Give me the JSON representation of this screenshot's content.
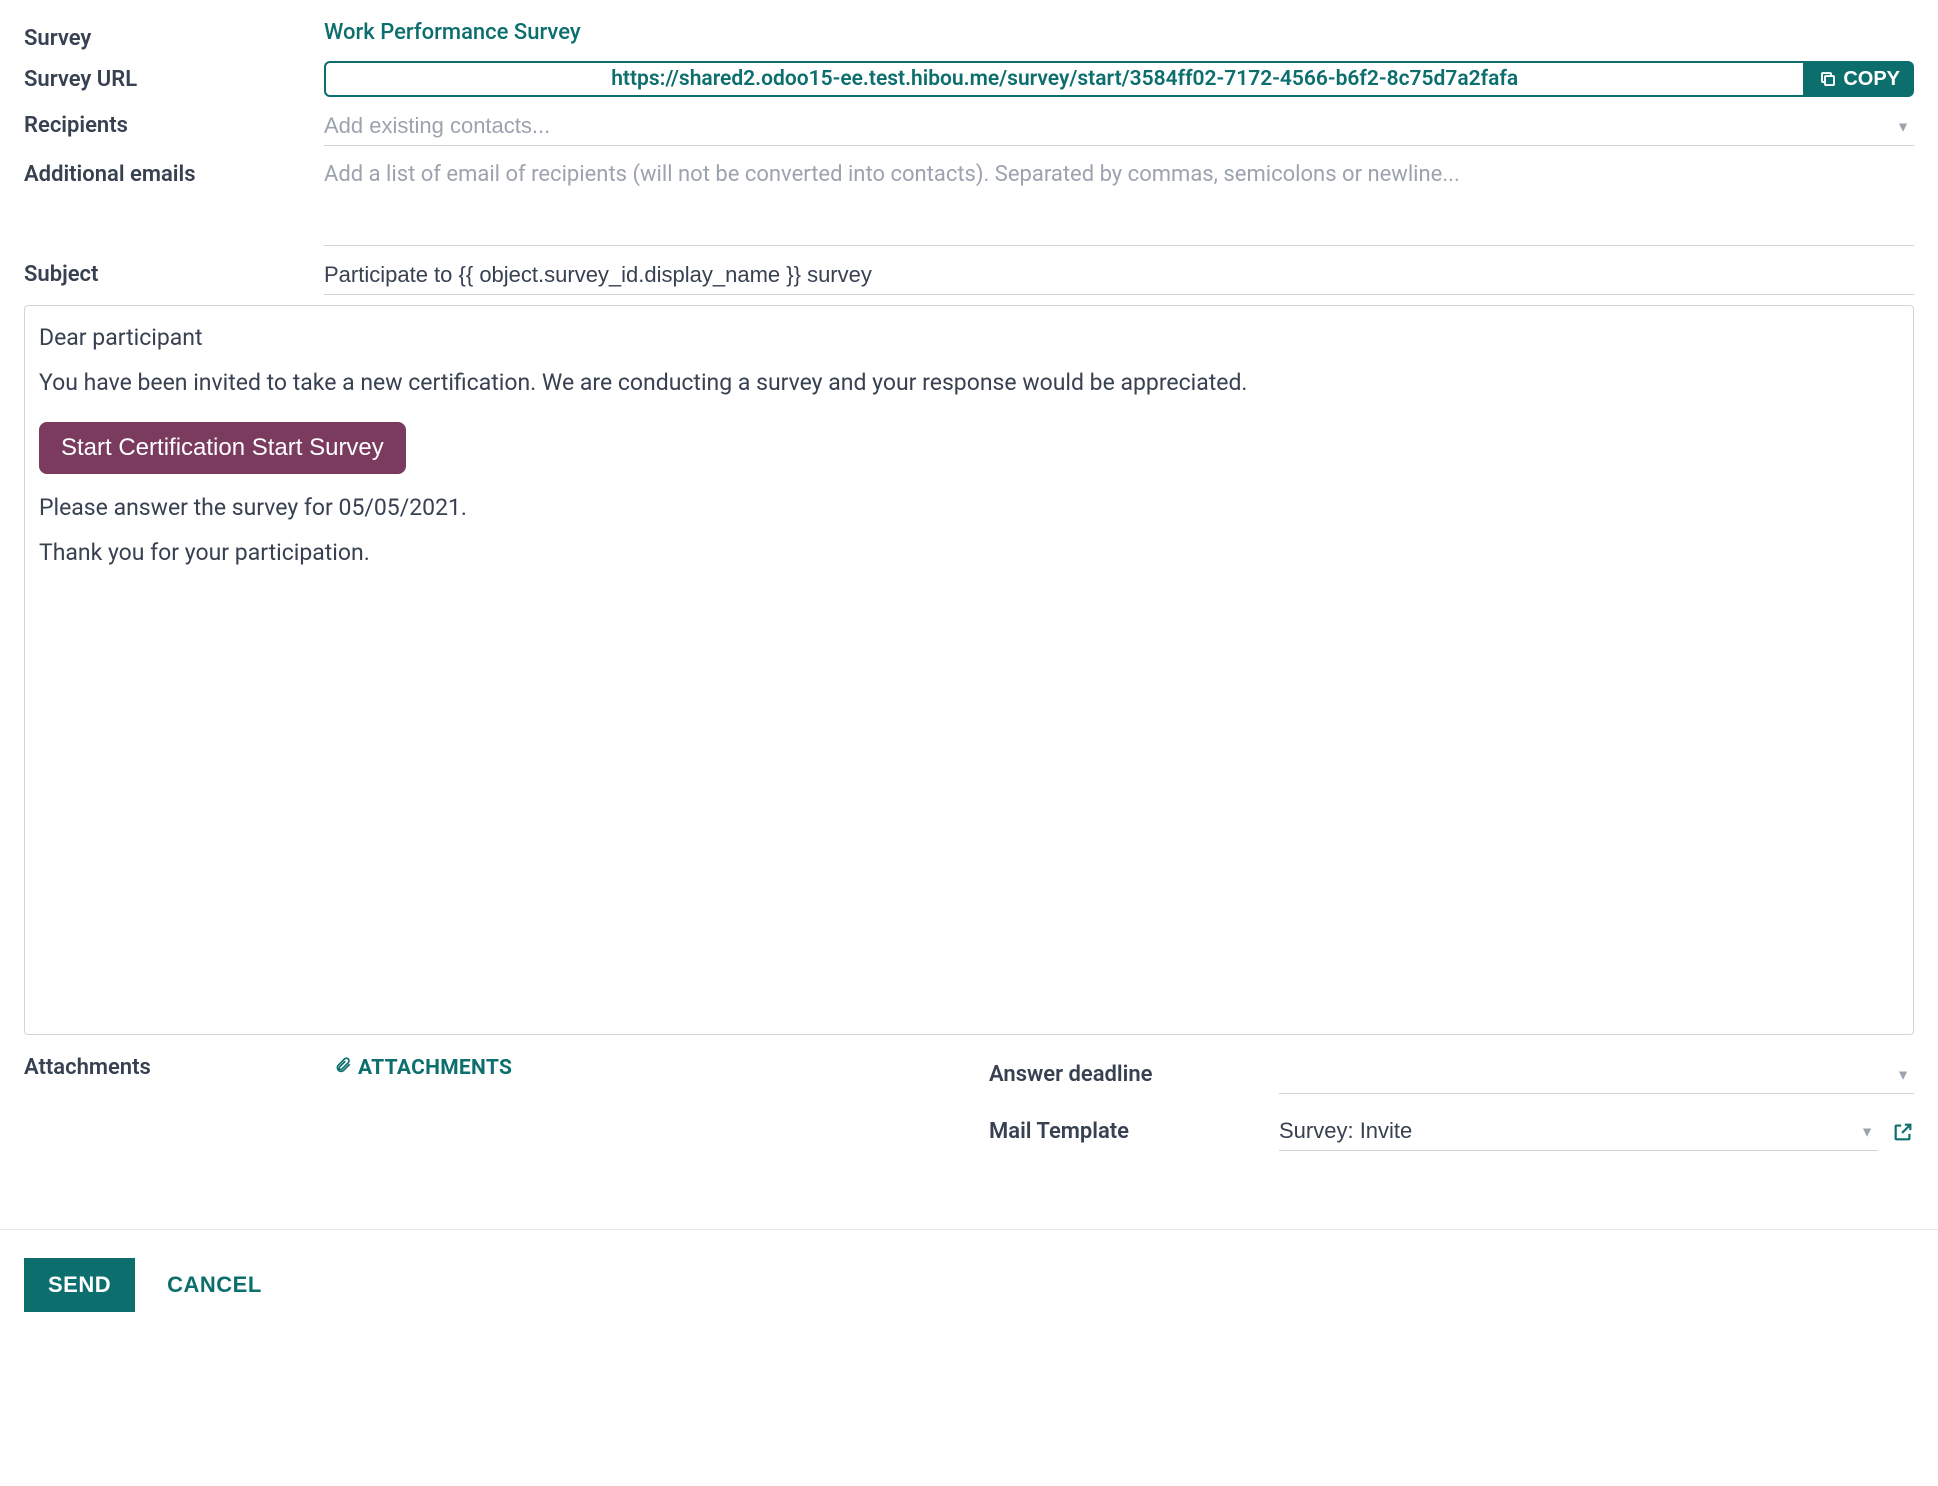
{
  "labels": {
    "survey": "Survey",
    "survey_url": "Survey URL",
    "recipients": "Recipients",
    "additional_emails": "Additional emails",
    "subject": "Subject",
    "attachments": "Attachments",
    "answer_deadline": "Answer deadline",
    "mail_template": "Mail Template"
  },
  "survey": {
    "name": "Work Performance Survey",
    "url": "https://shared2.odoo15-ee.test.hibou.me/survey/start/3584ff02-7172-4566-b6f2-8c75d7a2fafa",
    "copy_label": "COPY"
  },
  "recipients_placeholder": "Add existing contacts...",
  "additional_emails_placeholder": "Add a list of email of recipients (will not be converted into contacts). Separated by commas, semicolons or newline...",
  "subject_value": "Participate to {{ object.survey_id.display_name }} survey",
  "body": {
    "greeting": "Dear participant",
    "line1": "You have been invited to take a new certification. We are conducting a survey and your response would be appreciated.",
    "button_label": "Start Certification Start Survey",
    "line2": "Please answer the survey for 05/05/2021.",
    "line3": "Thank you for your participation."
  },
  "attachments_link": "ATTACHMENTS",
  "answer_deadline_value": "",
  "mail_template_value": "Survey: Invite",
  "footer": {
    "send": "SEND",
    "cancel": "CANCEL"
  }
}
